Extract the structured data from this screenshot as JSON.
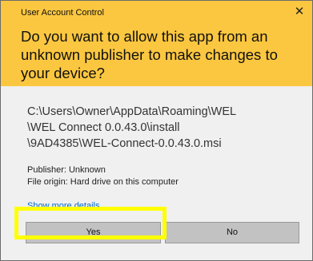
{
  "dialog": {
    "title": "User Account Control",
    "close_glyph": "✕",
    "question": "Do you want to allow this app from an unknown publisher to make changes to your device?",
    "path_lines": [
      "C:\\Users\\Owner\\AppData\\Roaming\\WEL",
      "\\WEL Connect 0.0.43.0\\install",
      "\\9AD4385\\WEL-Connect-0.0.43.0.msi"
    ],
    "publisher": "Publisher: Unknown",
    "file_origin": "File origin: Hard drive on this computer",
    "more_details": "Show more details",
    "yes_label": "Yes",
    "no_label": "No"
  },
  "colors": {
    "header_bg": "#fcc740",
    "body_bg": "#f0f0f0",
    "link": "#0066cc",
    "button_bg": "#c2c2c2",
    "highlight": "#ffff00"
  }
}
